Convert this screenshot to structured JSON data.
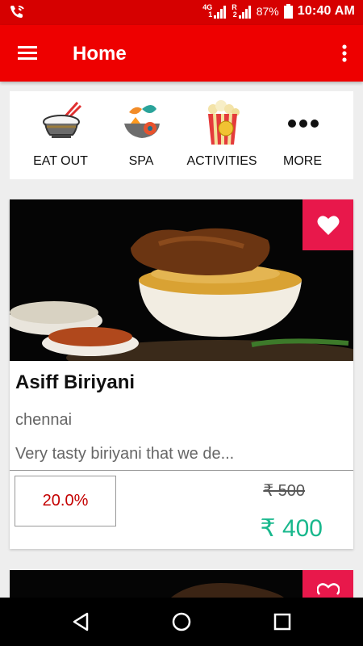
{
  "status_bar": {
    "network": "4G",
    "sim1": "1",
    "roaming": "R",
    "sim2": "2",
    "battery": "87%",
    "time": "10:40 AM",
    "icons": [
      "wifi-calling-icon",
      "signal-icon",
      "battery-icon"
    ]
  },
  "app_bar": {
    "title": "Home",
    "icons": [
      "menu-icon",
      "more-vert-icon"
    ]
  },
  "categories": [
    {
      "label": "EAT OUT",
      "icon": "rice-bowl-icon"
    },
    {
      "label": "SPA",
      "icon": "spa-icon"
    },
    {
      "label": "ACTIVITIES",
      "icon": "popcorn-icon"
    },
    {
      "label": "MORE",
      "icon": "more-dots-icon"
    }
  ],
  "deals": [
    {
      "title": "Asiff Biriyani",
      "city": "chennai",
      "description": "Very tasty biriyani that we de...",
      "discount": "20.0%",
      "old_price": "₹ 500",
      "new_price": "₹ 400",
      "favorited": true
    }
  ],
  "colors": {
    "primary": "#ee0000",
    "status_bar": "#d60000",
    "favorite": "#e8184b",
    "price": "#19b88d",
    "discount_text": "#c40000"
  },
  "nav_bar": {
    "icons": [
      "back-icon",
      "home-icon",
      "recents-icon"
    ]
  }
}
